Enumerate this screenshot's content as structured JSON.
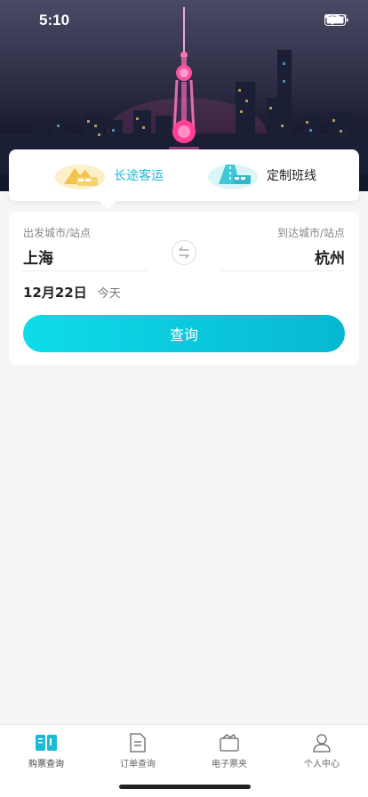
{
  "status_bar": {
    "time": "5:10"
  },
  "mode_tabs": [
    {
      "label": "长途客运",
      "icon": "mountain-bus-icon",
      "active": true
    },
    {
      "label": "定制班线",
      "icon": "road-bus-icon",
      "active": false
    }
  ],
  "search": {
    "from_caption": "出发城市/站点",
    "from_city": "上海",
    "to_caption": "到达城市/站点",
    "to_city": "杭州",
    "swap_icon": "swap-arrows-icon",
    "date": "12月22日",
    "day": "今天",
    "query_label": "查询"
  },
  "tabbar": {
    "items": [
      {
        "label": "购票查询",
        "icon": "ticket-book-icon",
        "active": true
      },
      {
        "label": "订单查询",
        "icon": "order-doc-icon",
        "active": false
      },
      {
        "label": "电子票夹",
        "icon": "ticket-folder-icon",
        "active": false
      },
      {
        "label": "个人中心",
        "icon": "person-icon",
        "active": false
      }
    ]
  },
  "colors": {
    "accent": "#1bbcd4",
    "button_start": "#0fdce8",
    "button_end": "#07b7d2"
  }
}
